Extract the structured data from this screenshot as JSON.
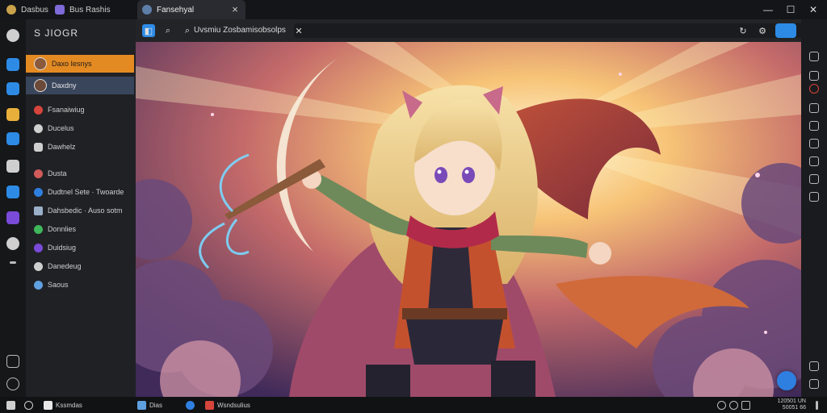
{
  "tabs": [
    {
      "label": "Dasbus",
      "active": false
    },
    {
      "label": "Bus Rashis",
      "active": false
    },
    {
      "label": "Fansehyal",
      "active": true
    }
  ],
  "window_controls": [
    "—",
    "☐",
    "✕"
  ],
  "sidebar": {
    "header": "S JIOGR",
    "items": [
      {
        "label": "Daxo Iesnys",
        "icon": "avatar",
        "color": "#8b5a3c"
      },
      {
        "label": "Daxdny",
        "icon": "avatar",
        "color": "#6c4a3a"
      },
      {
        "label": "Fsanaiwiug",
        "icon": "record-icon",
        "color": "#d6453b"
      },
      {
        "label": "Ducelus",
        "icon": "circle-icon",
        "color": "#cfcfcf"
      },
      {
        "label": "Dawhelz",
        "icon": "chat-icon",
        "color": "#cfcfcf"
      },
      {
        "label": "Dusta",
        "icon": "target-icon",
        "color": "#d15a5a"
      },
      {
        "label": "Dudtnel Sete · Twoarde",
        "icon": "blue-app-icon",
        "color": "#2f7fe0"
      },
      {
        "label": "Dahsbedic · Auso sotm",
        "icon": "doc-icon",
        "color": "#9ab0c8"
      },
      {
        "label": "Donnlies",
        "icon": "green-app-icon",
        "color": "#3fb65a"
      },
      {
        "label": "Duidsiug",
        "icon": "purple-app-icon",
        "color": "#7a4ad8"
      },
      {
        "label": "Danedeug",
        "icon": "disc-icon",
        "color": "#cfcfcf"
      },
      {
        "label": "Saous",
        "icon": "globe-icon",
        "color": "#5fa0e0"
      }
    ]
  },
  "address_bar": {
    "text": "Uvsmiu Zosbamisobsolps",
    "close_label": "✕"
  },
  "taskbar": {
    "items": [
      {
        "label": "Kssmdas",
        "color": "#e8e8e8"
      },
      {
        "label": "Dias",
        "color": "#5fa0e0"
      },
      {
        "label": "",
        "color": "#2f7fe0"
      },
      {
        "label": "Wsndsulius",
        "color": "#d6453b"
      }
    ],
    "clock_line1": "120501 UN",
    "clock_line2": "50051 66"
  },
  "colors": {
    "accent_orange": "#e48a22",
    "accent_blue": "#2d8be6"
  }
}
